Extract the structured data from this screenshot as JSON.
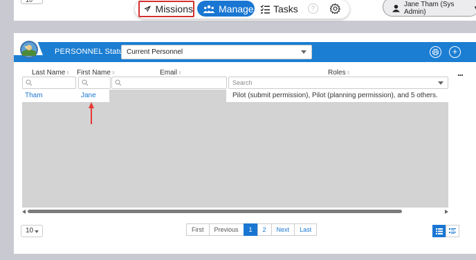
{
  "topbar": {
    "page_size_partial": "10",
    "nav": {
      "missions_label": "Missions",
      "manage_label": "Manage",
      "tasks_label": "Tasks",
      "help_label": "?"
    },
    "user": {
      "name": "Jane Tham (Sys Admin)"
    }
  },
  "panel": {
    "title": "PERSONNEL",
    "status_label": "Status:",
    "status_value": "Current Personnel",
    "print_icon": "printer-icon",
    "add_label": "+",
    "more_label": "..."
  },
  "table": {
    "columns": [
      {
        "label": "Last Name"
      },
      {
        "label": "First Name"
      },
      {
        "label": "Email"
      },
      {
        "label": "Roles"
      }
    ],
    "roles_filter_placeholder": "Search",
    "rows": [
      {
        "last_name": "Tham",
        "first_name": "Jane",
        "email": "",
        "roles": "Pilot (submit permission), Pilot (planning permission), and 5 others."
      }
    ]
  },
  "pagination": {
    "page_size": "10",
    "first": "First",
    "previous": "Previous",
    "pages": [
      "1",
      "2"
    ],
    "current_page": "1",
    "next": "Next",
    "last": "Last"
  },
  "colors": {
    "accent": "#1976d2",
    "header_blue": "#1b7ed3",
    "highlight_red": "#d32f2f",
    "row_grey": "#d3d3d3"
  }
}
